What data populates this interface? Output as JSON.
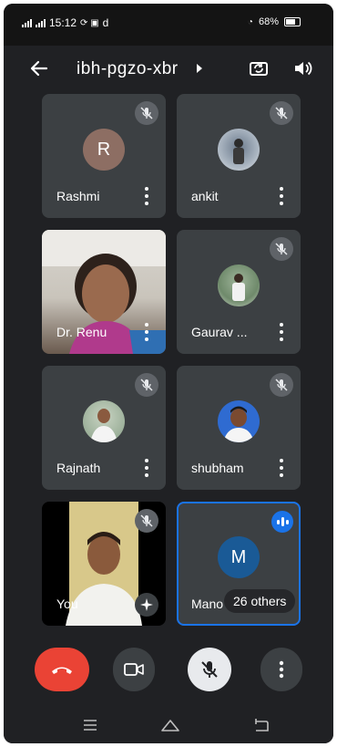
{
  "status_bar": {
    "time": "15:12",
    "extra_icons": "d",
    "battery": "68%"
  },
  "header": {
    "meeting_code": "ibh-pgzo-xbr"
  },
  "participants": [
    {
      "name": "Rashmi",
      "initial": "R",
      "avatar_color": "#8d6e63",
      "muted": true
    },
    {
      "name": "ankit",
      "muted": true
    },
    {
      "name": "Dr. Renu",
      "muted": false
    },
    {
      "name": "Gaurav ...",
      "muted": true
    },
    {
      "name": "Rajnath",
      "muted": true
    },
    {
      "name": "shubham",
      "muted": true
    },
    {
      "name": "You",
      "muted": true
    },
    {
      "name": "Mano",
      "initial": "M",
      "avatar_color": "#1a5a96",
      "speaking": true,
      "others_label": "26 others"
    }
  ],
  "colors": {
    "background": "#202124",
    "tile": "#3c4043",
    "end_call": "#ea4335",
    "accent": "#1a73e8"
  }
}
